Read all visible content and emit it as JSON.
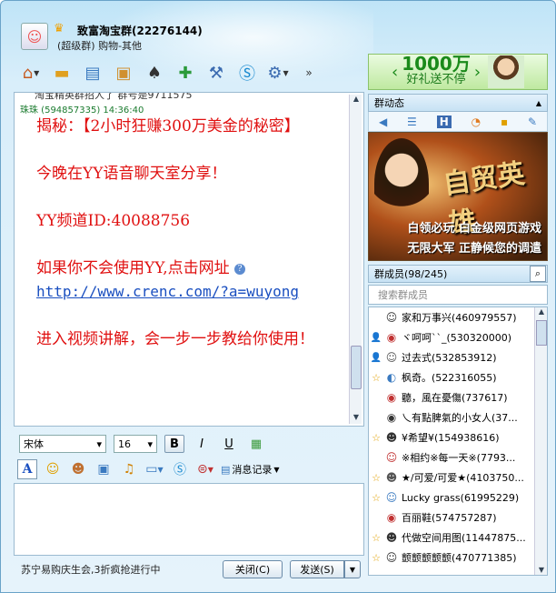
{
  "window": {
    "title": "致富淘宝群(22276144)",
    "subtitle": "(超级群) 购物-其他"
  },
  "ad": {
    "amount": "1000万",
    "slogan": "好礼送不停"
  },
  "chat": {
    "prev_line": "淘宝精英群招人了 群号是9711575",
    "sender": "珠珠 (594857335)   14:36:40",
    "messages": [
      "揭秘：【2小时狂赚300万美金的秘密】",
      "今晚在YY语音聊天室分享！",
      "YY频道ID:40088756",
      "如果你不会使用YY,点击网址"
    ],
    "link": "http://www.crenc.com/?a=wuyong",
    "last": "进入视频讲解，会一步一步教给你使用！"
  },
  "format": {
    "font": "宋体",
    "size": "16",
    "bold": "B",
    "italic": "I",
    "underline": "U"
  },
  "controls": {
    "history": "消息记录"
  },
  "bottom": {
    "status": "苏宁易购庆生会,3折疯抢进行中",
    "close": "关闭(C)",
    "send": "发送(S)"
  },
  "group": {
    "news_title": "群动态",
    "ad_title": "自贸英雄",
    "ad_line1": "白领必玩 白金级网页游戏",
    "ad_line2": "无限大军 正静候您的调遣",
    "members_title": "群成员(98/245)",
    "search_placeholder": "搜索群成员",
    "members": [
      {
        "badge": "",
        "name": "家和万事兴(460979557)"
      },
      {
        "badge": "person",
        "name": "ヾ呵呵``_(530320000)"
      },
      {
        "badge": "person",
        "name": "过去式(532853912)"
      },
      {
        "badge": "star",
        "name": "枫奇。(522316055)"
      },
      {
        "badge": "",
        "name": "聽，風在憂傷(737617)"
      },
      {
        "badge": "",
        "name": "乀有點脾氣的小女人(37..."
      },
      {
        "badge": "star",
        "name": "¥希望¥(154938616)"
      },
      {
        "badge": "",
        "name": "※相约※每一天※(7793..."
      },
      {
        "badge": "star",
        "name": "★/可爱/可爱★(4103750..."
      },
      {
        "badge": "star",
        "name": "Lucky grass(61995229)"
      },
      {
        "badge": "",
        "name": "百丽鞋(574757287)"
      },
      {
        "badge": "star",
        "name": "代做空间用图(11447875..."
      },
      {
        "badge": "star",
        "name": "颤颤颤颤颤(470771385)"
      }
    ]
  },
  "icons": {
    "avatar": "group-avatar-icon"
  }
}
